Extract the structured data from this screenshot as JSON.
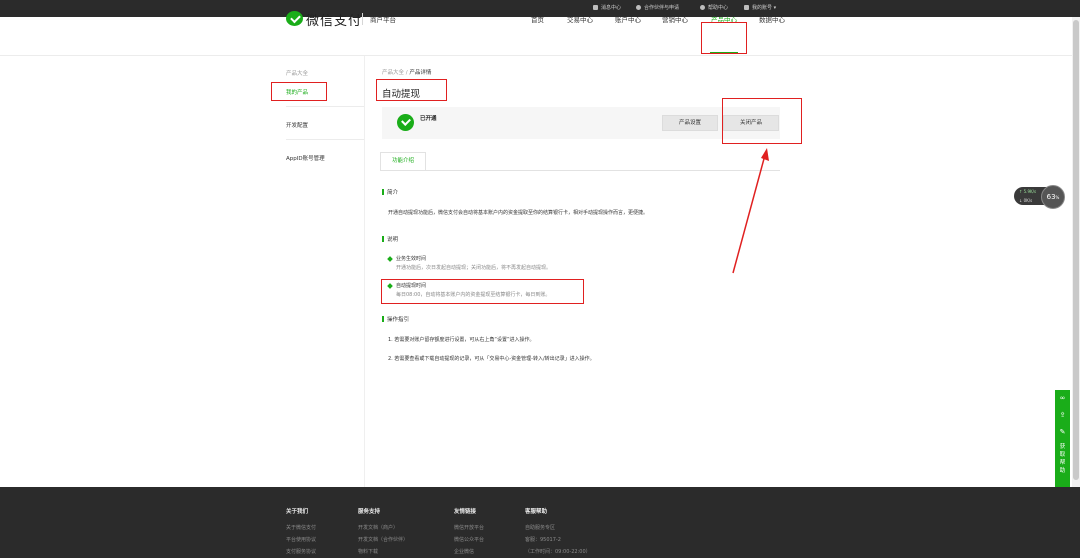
{
  "topbar": {
    "items": [
      "消息中心",
      "合作伙伴与申请",
      "帮助中心",
      "我的账号"
    ]
  },
  "header": {
    "brand": "微信支付",
    "platform": "商户平台",
    "nav": [
      "首页",
      "交易中心",
      "账户中心",
      "营销中心",
      "产品中心",
      "数据中心"
    ],
    "active_nav": "产品中心"
  },
  "sidebar": {
    "items": [
      "产品大全",
      "我的产品",
      "开发配置",
      "AppID账号管理"
    ],
    "active": "我的产品"
  },
  "breadcrumb": {
    "parent": "产品大全",
    "separator": "/",
    "current": "产品详情"
  },
  "product": {
    "title": "自动提现",
    "status": "已开通",
    "settings_button": "产品设置",
    "close_button": "关闭产品"
  },
  "tabs": [
    "功能介绍"
  ],
  "sections": {
    "intro_heading": "简介",
    "intro_text": "开通自动提现功能后，微信支付会自动将基本账户内的资金提取至你的结算银行卡，相对手动提现操作而言，更便捷。",
    "desc_heading": "说明",
    "desc_items": [
      {
        "title": "业务生效时间",
        "text": "开通功能后，次日发起自动提现；关闭功能后，将不再发起自动提现。"
      },
      {
        "title": "自动提现时间",
        "text": "每日08:00，自动将基本账户内的资金提现至结算银行卡，每日到账。"
      }
    ],
    "guide_heading": "操作指引",
    "guide_items": [
      "1. 若需要对账户留存额度进行设置，可从右上角“设置”进入操作。",
      "2. 若需要查看或下载自动提现的记录，可从「交易中心-资金管理-转入/转出记录」进入操作。"
    ]
  },
  "widgets": {
    "net_up": "↑ 5.9K/s",
    "net_down": "↓ 0K/s",
    "percent": "63",
    "percent_unit": "%",
    "help": [
      "获",
      "取",
      "帮",
      "助"
    ]
  },
  "footer": {
    "columns": [
      {
        "heading": "关于我们",
        "links": [
          "关于微信支付",
          "平台使用协议",
          "支付服务协议"
        ]
      },
      {
        "heading": "服务支持",
        "links": [
          "开发文档（商户）",
          "开发文档（合作伙伴）",
          "物料下载"
        ]
      },
      {
        "heading": "友情链接",
        "links": [
          "微信开放平台",
          "微信公众平台",
          "企业微信"
        ]
      },
      {
        "heading": "客服帮助",
        "links": [
          "自助服务专区",
          "客服：95017-2",
          "（工作时间：09:00-22:00）"
        ]
      }
    ]
  },
  "colors": {
    "accent": "#1aad19",
    "annotation": "#e02020",
    "topbar": "#2b2b2b"
  }
}
